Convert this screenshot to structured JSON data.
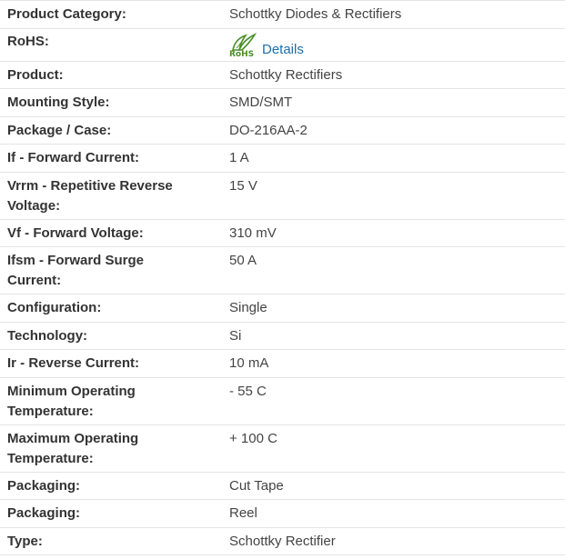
{
  "specs": [
    {
      "label": "Product Category:",
      "value": "Schottky Diodes & Rectifiers"
    },
    {
      "label": "RoHS:",
      "value": "Details",
      "logo_text": "RoHS"
    },
    {
      "label": "Product:",
      "value": "Schottky Rectifiers"
    },
    {
      "label": "Mounting Style:",
      "value": "SMD/SMT"
    },
    {
      "label": "Package / Case:",
      "value": "DO-216AA-2"
    },
    {
      "label": "If - Forward Current:",
      "value": "1 A"
    },
    {
      "label_line1": "Vrrm - Repetitive Reverse",
      "label_line2": "Voltage:",
      "value": "15 V"
    },
    {
      "label": "Vf - Forward Voltage:",
      "value": "310 mV"
    },
    {
      "label_line1": "Ifsm - Forward Surge",
      "label_line2": "Current:",
      "value": "50 A"
    },
    {
      "label": "Configuration:",
      "value": "Single"
    },
    {
      "label": "Technology:",
      "value": "Si"
    },
    {
      "label": "Ir - Reverse Current:",
      "value": "10 mA"
    },
    {
      "label_line1": "Minimum Operating",
      "label_line2": "Temperature:",
      "value": "- 55 C"
    },
    {
      "label_line1": "Maximum Operating",
      "label_line2": "Temperature:",
      "value": "+ 100 C"
    },
    {
      "label": "Packaging:",
      "value": "Cut Tape"
    },
    {
      "label": "Packaging:",
      "value": "Reel"
    },
    {
      "label": "Type:",
      "value": "Schottky Rectifier"
    }
  ],
  "colors": {
    "link": "#1c6fae",
    "rohs_green": "#4a8f2a",
    "border": "#e4e4e4"
  },
  "icons": {
    "rohs": "rohs-leaf-icon"
  }
}
